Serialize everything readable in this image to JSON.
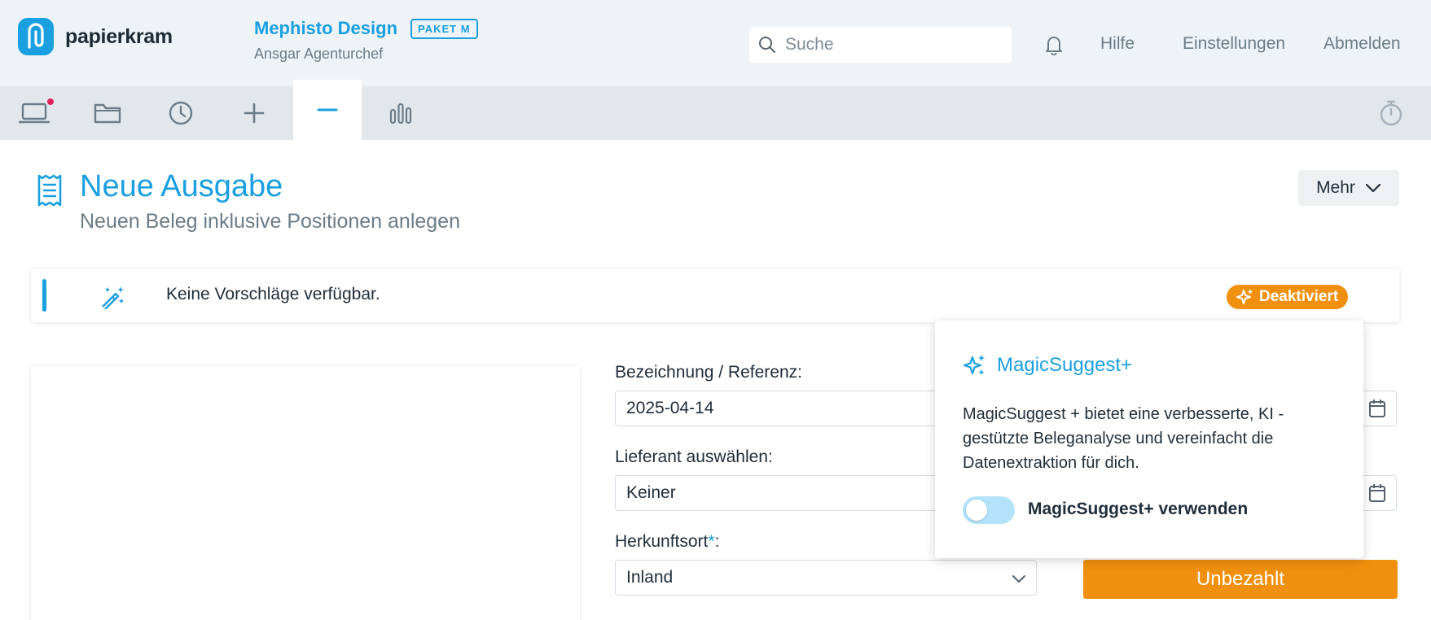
{
  "brand": {
    "name": "papierkram"
  },
  "company": {
    "name": "Mephisto Design",
    "package": "PAKET M",
    "user": "Ansgar Agenturchef"
  },
  "search": {
    "placeholder": "Suche",
    "icon": "search-icon"
  },
  "header_nav": {
    "help": "Hilfe",
    "settings": "Einstellungen",
    "logout": "Abmelden"
  },
  "toolbar": {
    "items": [
      {
        "icon": "laptop-icon",
        "has_notification": true
      },
      {
        "icon": "folder-icon"
      },
      {
        "icon": "clock-icon"
      },
      {
        "icon": "plus-icon"
      },
      {
        "icon": "minus-icon",
        "active": true
      },
      {
        "icon": "bar-chart-icon"
      }
    ],
    "right_icon": "stopwatch-icon"
  },
  "page": {
    "title": "Neue Ausgabe",
    "subtitle": "Neuen Beleg inklusive Positionen anlegen",
    "more_button": "Mehr"
  },
  "suggest": {
    "text": "Keine Vorschläge verfügbar.",
    "badge": "Deaktiviert"
  },
  "form": {
    "reference_label": "Bezeichnung / Referenz:",
    "reference_value": "2025-04-14",
    "supplier_label": "Lieferant auswählen:",
    "supplier_value": "Keiner",
    "origin_label": "Herkunftsort",
    "origin_required": "*",
    "origin_colon": ":",
    "origin_value": "Inland",
    "status_button": "Unbezahlt"
  },
  "popover": {
    "title": "MagicSuggest+",
    "body": "MagicSuggest + bietet eine verbesserte, KI - gestützte Beleganalyse und vereinfacht die Datenextraktion für dich.",
    "toggle_label": "MagicSuggest+ verwenden",
    "toggle_on": false
  },
  "colors": {
    "accent": "#1a9fe0",
    "orange": "#f0900e",
    "header_bg": "#eef3f7",
    "toolbar_bg": "#e2e7eb",
    "notification": "#e0245e"
  }
}
